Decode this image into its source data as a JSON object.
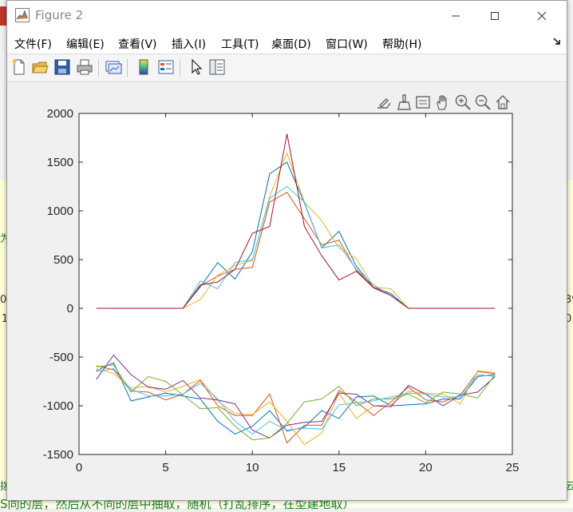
{
  "window": {
    "title": "Figure 2",
    "controls": {
      "minimize": "—",
      "maximize": "☐",
      "close": "✕"
    }
  },
  "menu": {
    "items": [
      "文件(F)",
      "编辑(E)",
      "查看(V)",
      "插入(I)",
      "工具(T)",
      "桌面(D)",
      "窗口(W)",
      "帮助(H)"
    ]
  },
  "toolbar": {
    "buttons": [
      "new-figure-icon",
      "open-file-icon",
      "save-icon",
      "print-icon",
      "link-plot-icon",
      "colorbar-icon",
      "legend-icon",
      "edit-plot-arrow-icon",
      "property-inspector-icon"
    ]
  },
  "axes_toolbar": {
    "buttons": [
      "export-icon",
      "brush-icon",
      "data-tips-icon",
      "pan-icon",
      "zoom-in-icon",
      "zoom-out-icon",
      "home-icon"
    ]
  },
  "background": {
    "bottom_text": "S同的层，然后从不同的层中抽取，随机（打乱排序，在型建地取）",
    "edge_left_texts": [
      "为",
      "0€",
      "1"
    ],
    "edge_right_texts": [
      "39",
      "0."
    ],
    "bottom_left_char": "拨",
    "bottom_right_char": "云"
  },
  "colors": {
    "blue": "#0072bd",
    "orange": "#d95319",
    "yellow": "#edb120",
    "purple": "#7e2f8e",
    "green": "#77ac30",
    "lightblue": "#4dbeee",
    "red": "#a2142f"
  },
  "chart_data": {
    "type": "line",
    "title": "",
    "xlabel": "",
    "ylabel": "",
    "xlim": [
      0,
      25
    ],
    "ylim": [
      -1500,
      2000
    ],
    "xticks": [
      0,
      5,
      10,
      15,
      20,
      25
    ],
    "yticks": [
      -1500,
      -1000,
      -500,
      0,
      500,
      1000,
      1500,
      2000
    ],
    "grid": false,
    "upper_series": [
      {
        "color": "#0072bd",
        "x": [
          1,
          2,
          3,
          4,
          5,
          6,
          7,
          8,
          9,
          10,
          11,
          12,
          13,
          14,
          15,
          16,
          17,
          18,
          19,
          20,
          21,
          22,
          23,
          24
        ],
        "values": [
          0,
          0,
          0,
          0,
          0,
          0,
          220,
          470,
          300,
          580,
          1380,
          1500,
          1080,
          620,
          790,
          430,
          220,
          150,
          0,
          0,
          0,
          0,
          0,
          0
        ]
      },
      {
        "color": "#d95319",
        "x": [
          1,
          2,
          3,
          4,
          5,
          6,
          7,
          8,
          9,
          10,
          11,
          12,
          13,
          14,
          15,
          16,
          17,
          18,
          19,
          20,
          21,
          22,
          23,
          24
        ],
        "values": [
          0,
          0,
          0,
          0,
          0,
          0,
          230,
          330,
          400,
          420,
          1090,
          1190,
          920,
          650,
          700,
          390,
          220,
          130,
          0,
          0,
          0,
          0,
          0,
          0
        ]
      },
      {
        "color": "#edb120",
        "x": [
          1,
          2,
          3,
          4,
          5,
          6,
          7,
          8,
          9,
          10,
          11,
          12,
          13,
          14,
          15,
          16,
          17,
          18,
          19,
          20,
          21,
          22,
          23,
          24
        ],
        "values": [
          0,
          0,
          0,
          0,
          0,
          0,
          90,
          340,
          440,
          490,
          1150,
          1590,
          1090,
          900,
          620,
          510,
          220,
          200,
          0,
          0,
          0,
          0,
          0,
          0
        ]
      },
      {
        "color": "#4dbeee",
        "x": [
          1,
          2,
          3,
          4,
          5,
          6,
          7,
          8,
          9,
          10,
          11,
          12,
          13,
          14,
          15,
          16,
          17,
          18,
          19,
          20,
          21,
          22,
          23,
          24
        ],
        "values": [
          0,
          0,
          0,
          0,
          0,
          0,
          280,
          200,
          470,
          500,
          1130,
          1250,
          1090,
          620,
          650,
          400,
          240,
          130,
          0,
          0,
          0,
          0,
          0,
          0
        ]
      },
      {
        "color": "#a2142f",
        "x": [
          1,
          2,
          3,
          4,
          5,
          6,
          7,
          8,
          9,
          10,
          11,
          12,
          13,
          14,
          15,
          16,
          17,
          18,
          19,
          20,
          21,
          22,
          23,
          24
        ],
        "values": [
          0,
          0,
          0,
          0,
          0,
          0,
          240,
          270,
          400,
          770,
          840,
          1790,
          840,
          540,
          290,
          380,
          210,
          130,
          0,
          0,
          0,
          0,
          0,
          0
        ]
      }
    ],
    "lower_series": [
      {
        "color": "#0072bd",
        "x": [
          1,
          2,
          3,
          4,
          5,
          6,
          7,
          8,
          9,
          10,
          11,
          12,
          13,
          14,
          15,
          16,
          17,
          18,
          19,
          20,
          21,
          22,
          23,
          24
        ],
        "values": [
          -640,
          -560,
          -950,
          -910,
          -870,
          -900,
          -930,
          -1160,
          -1290,
          -1210,
          -1050,
          -1260,
          -1220,
          -1050,
          -1130,
          -910,
          -900,
          -1000,
          -990,
          -980,
          -930,
          -930,
          -700,
          -680
        ]
      },
      {
        "color": "#d95319",
        "x": [
          1,
          2,
          3,
          4,
          5,
          6,
          7,
          8,
          9,
          10,
          11,
          12,
          13,
          14,
          15,
          16,
          17,
          18,
          19,
          20,
          21,
          22,
          23,
          24
        ],
        "values": [
          -590,
          -630,
          -850,
          -860,
          -940,
          -880,
          -740,
          -1000,
          -1100,
          -1100,
          -880,
          -1380,
          -1200,
          -1200,
          -840,
          -960,
          -1100,
          -960,
          -810,
          -940,
          -960,
          -890,
          -650,
          -670
        ]
      },
      {
        "color": "#edb120",
        "x": [
          1,
          2,
          3,
          4,
          5,
          6,
          7,
          8,
          9,
          10,
          11,
          12,
          13,
          14,
          15,
          16,
          17,
          18,
          19,
          20,
          21,
          22,
          23,
          24
        ],
        "values": [
          -620,
          -670,
          -820,
          -800,
          -860,
          -800,
          -730,
          -950,
          -1080,
          -1090,
          -960,
          -1160,
          -1400,
          -1280,
          -870,
          -1130,
          -1000,
          -990,
          -850,
          -870,
          -880,
          -980,
          -640,
          -660
        ]
      },
      {
        "color": "#7e2f8e",
        "x": [
          1,
          2,
          3,
          4,
          5,
          6,
          7,
          8,
          9,
          10,
          11,
          12,
          13,
          14,
          15,
          16,
          17,
          18,
          19,
          20,
          21,
          22,
          23,
          24
        ],
        "values": [
          -730,
          -480,
          -680,
          -810,
          -830,
          -740,
          -920,
          -940,
          -980,
          -1250,
          -1330,
          -1200,
          -1170,
          -1160,
          -870,
          -880,
          -1000,
          -1010,
          -790,
          -880,
          -1000,
          -890,
          -860,
          -700
        ]
      },
      {
        "color": "#77ac30",
        "x": [
          1,
          2,
          3,
          4,
          5,
          6,
          7,
          8,
          9,
          10,
          11,
          12,
          13,
          14,
          15,
          16,
          17,
          18,
          19,
          20,
          21,
          22,
          23,
          24
        ],
        "values": [
          -600,
          -580,
          -860,
          -700,
          -750,
          -890,
          -1030,
          -1020,
          -1210,
          -1350,
          -1330,
          -1180,
          -960,
          -930,
          -800,
          -1000,
          -930,
          -930,
          -880,
          -970,
          -860,
          -880,
          -920,
          -680
        ]
      },
      {
        "color": "#4dbeee",
        "x": [
          1,
          2,
          3,
          4,
          5,
          6,
          7,
          8,
          9,
          10,
          11,
          12,
          13,
          14,
          15,
          16,
          17,
          18,
          19,
          20,
          21,
          22,
          23,
          24
        ],
        "values": [
          -650,
          -620,
          -830,
          -900,
          -900,
          -880,
          -770,
          -930,
          -1160,
          -1290,
          -1160,
          -1250,
          -1230,
          -1240,
          -990,
          -970,
          -950,
          -910,
          -870,
          -880,
          -910,
          -910,
          -680,
          -700
        ]
      }
    ]
  }
}
